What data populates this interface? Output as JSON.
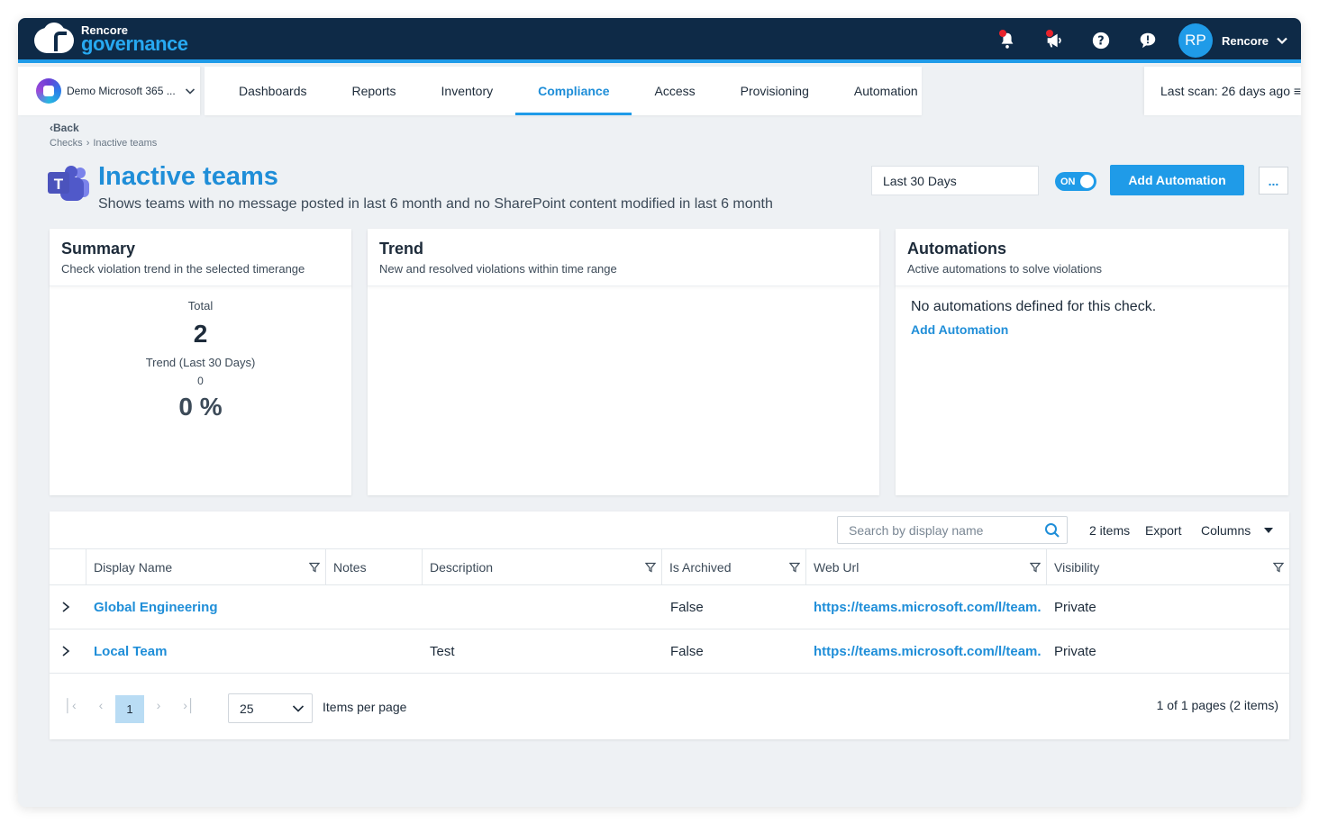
{
  "app": {
    "logo_small": "Rencore",
    "logo_big": "governance"
  },
  "user": {
    "initials": "RP",
    "name": "Rencore"
  },
  "tenant": {
    "name": "Demo Microsoft 365 ..."
  },
  "nav": {
    "tabs": [
      "Dashboards",
      "Reports",
      "Inventory",
      "Compliance",
      "Access",
      "Provisioning",
      "Automation"
    ],
    "active": "Compliance"
  },
  "last_scan": {
    "label": "Last scan:",
    "value": "26 days ago"
  },
  "breadcrumb": {
    "back": "Back",
    "items": [
      "Checks",
      "Inactive teams"
    ]
  },
  "page": {
    "title": "Inactive teams",
    "subtitle": "Shows teams with no message posted in last 6 month and no SharePoint content modified in last 6 month",
    "range": "Last 30 Days",
    "toggle": "ON",
    "add_automation": "Add Automation",
    "more": "..."
  },
  "summary": {
    "title": "Summary",
    "subtitle": "Check violation trend in the selected timerange",
    "total_label": "Total",
    "total": "2",
    "trend_label": "Trend (Last 30 Days)",
    "trend_value": "0",
    "percent": "0 %"
  },
  "trend": {
    "title": "Trend",
    "subtitle": "New and resolved violations within time range"
  },
  "automations": {
    "title": "Automations",
    "subtitle": "Active automations to solve violations",
    "empty": "No automations defined for this check.",
    "link": "Add Automation"
  },
  "table": {
    "search_placeholder": "Search by display name",
    "count": "2 items",
    "export": "Export",
    "columns": "Columns",
    "headers": [
      "Display Name",
      "Notes",
      "Description",
      "Is Archived",
      "Web Url",
      "Visibility"
    ],
    "rows": [
      {
        "display_name": "Global Engineering",
        "notes": "",
        "description": "",
        "is_archived": "False",
        "web_url": "https://teams.microsoft.com/l/team...",
        "visibility": "Private"
      },
      {
        "display_name": "Local Team",
        "notes": "",
        "description": "Test",
        "is_archived": "False",
        "web_url": "https://teams.microsoft.com/l/team...",
        "visibility": "Private"
      }
    ],
    "pager": {
      "current": "1",
      "page_size": "25",
      "per_page_label": "Items per page",
      "info": "1 of 1 pages (2 items)"
    }
  },
  "colors": {
    "navy": "#0e2a47",
    "accent": "#1f9be8",
    "link": "#1f8ed8",
    "alert": "#e8232c"
  },
  "icons": [
    "bell-icon",
    "megaphone-icon",
    "help-icon",
    "feedback-icon",
    "chevron-down-icon",
    "teams-icon",
    "search-icon",
    "filter-icon",
    "chevron-right-icon"
  ]
}
